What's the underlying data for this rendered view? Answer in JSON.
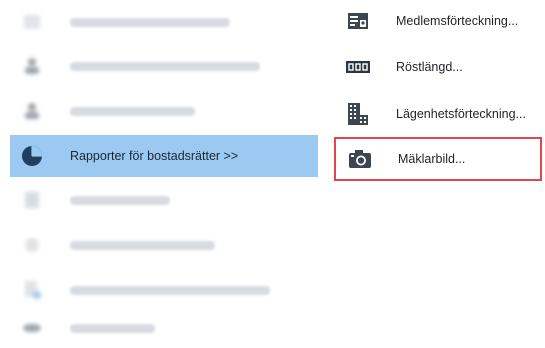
{
  "left_menu": {
    "active_item": {
      "label": "Rapporter för bostadsrätter >>",
      "icon": "pie-chart-icon"
    },
    "blurred_items": [
      {
        "icon": "table-icon"
      },
      {
        "icon": "person-warning-icon"
      },
      {
        "icon": "person-icon"
      },
      {
        "icon": "document-list-icon"
      },
      {
        "icon": "settings-icon"
      },
      {
        "icon": "document-icon"
      },
      {
        "icon": "eye-icon"
      }
    ]
  },
  "submenu": {
    "items": [
      {
        "label": "Medlemsförteckning...",
        "icon": "member-card-icon"
      },
      {
        "label": "Röstlängd...",
        "icon": "ballot-counter-icon"
      },
      {
        "label": "Lägenhetsförteckning...",
        "icon": "apartment-building-icon"
      },
      {
        "label": "Mäklarbild...",
        "icon": "camera-icon",
        "highlighted": true
      }
    ]
  },
  "colors": {
    "active_background": "#9bc9f1",
    "highlight_border": "#e0474c",
    "text": "#1f2328"
  }
}
